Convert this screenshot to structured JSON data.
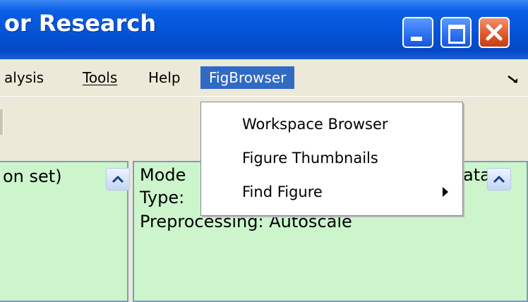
{
  "window": {
    "title": "or Research",
    "controls": [
      "minimize",
      "maximize",
      "close"
    ]
  },
  "menubar": {
    "items": [
      {
        "label": "alysis"
      },
      {
        "label": "Tools"
      },
      {
        "label": "Help"
      },
      {
        "label": "FigBrowser",
        "active": true
      }
    ],
    "overflow_icon": "menu-overflow-arrow"
  },
  "dropdown": {
    "items": [
      {
        "label": "Workspace Browser"
      },
      {
        "label": "Figure Thumbnails"
      },
      {
        "label": "Find Figure",
        "has_submenu": true
      }
    ]
  },
  "left_pane": {
    "text": "on set)"
  },
  "right_pane": {
    "lines": [
      "Mode",
      "Type:",
      "Preprocessing: Autoscale"
    ],
    "right_fragment": "ata"
  },
  "colors": {
    "titlebar": "#0553d6",
    "menu_active": "#316ac5",
    "pane_bg": "#ccf5cc",
    "close_button": "#e05a2a"
  }
}
